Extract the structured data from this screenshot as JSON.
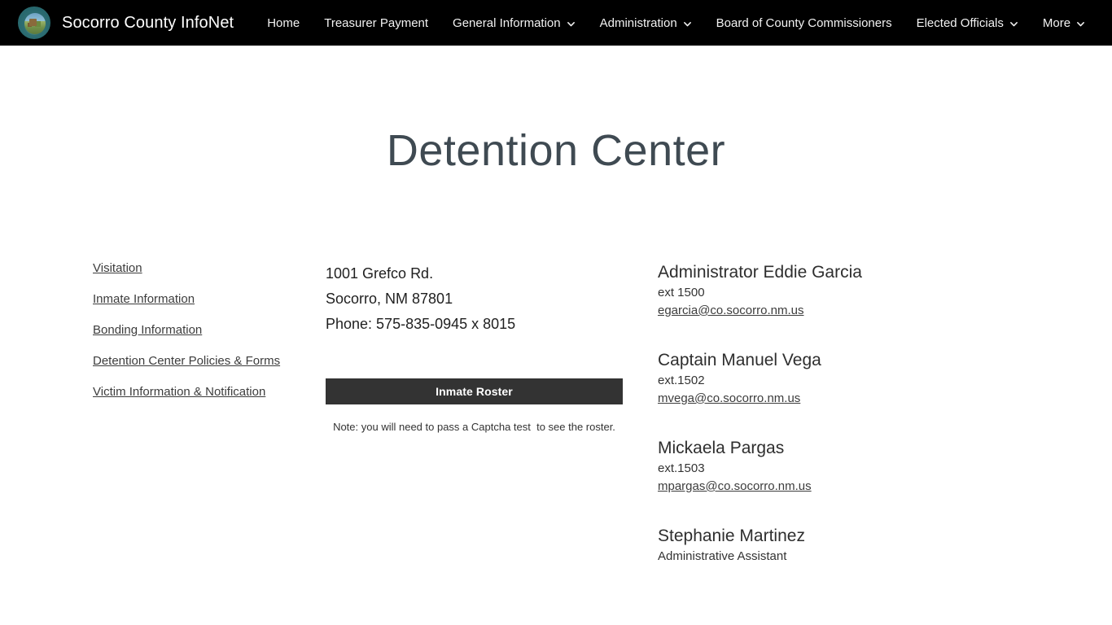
{
  "navbar": {
    "logo_icon": "county-seal-icon",
    "brand_title": "Socorro County InfoNet",
    "items": [
      {
        "label": "Home",
        "has_dropdown": false
      },
      {
        "label": "Treasurer Payment",
        "has_dropdown": false
      },
      {
        "label": "General Information",
        "has_dropdown": true,
        "dropdown_icon": "chevron-down-icon"
      },
      {
        "label": "Administration",
        "has_dropdown": true,
        "dropdown_icon": "chevron-down-icon"
      },
      {
        "label": "Board of County Commissioners",
        "has_dropdown": false
      },
      {
        "label": "Elected Officials",
        "has_dropdown": true,
        "dropdown_icon": "chevron-down-icon"
      },
      {
        "label": "More",
        "has_dropdown": true,
        "dropdown_icon": "chevron-down-icon"
      }
    ],
    "background_color": "#000000",
    "text_color": "#f2f2f2"
  },
  "page": {
    "title": "Detention Center"
  },
  "sidebar": {
    "links": [
      {
        "label": "Visitation"
      },
      {
        "label": "Inmate Information"
      },
      {
        "label": "Bonding Information"
      },
      {
        "label": "Detention Center Policies & Forms"
      },
      {
        "label": "Victim Information & Notification"
      }
    ]
  },
  "contact": {
    "address_lines": [
      "1001 Grefco Rd.",
      "Socorro, NM 87801",
      "Phone: 575-835-0945 x 8015"
    ],
    "roster_button_label": "Inmate Roster",
    "roster_button_color": "#333333",
    "roster_note": "Note: you will need to pass a Captcha test  to see the roster."
  },
  "staff": {
    "members": [
      {
        "name": "Administrator Eddie Garcia",
        "ext": "ext 1500",
        "email": "egarcia@co.socorro.nm.us"
      },
      {
        "name": "Captain Manuel Vega",
        "ext": "ext.1502",
        "email": "mvega@co.socorro.nm.us"
      },
      {
        "name": "Mickaela Pargas",
        "ext": "ext.1503",
        "email": "mpargas@co.socorro.nm.us"
      },
      {
        "name": "Stephanie Martinez",
        "ext": "Administrative Assistant",
        "email": ""
      }
    ]
  }
}
